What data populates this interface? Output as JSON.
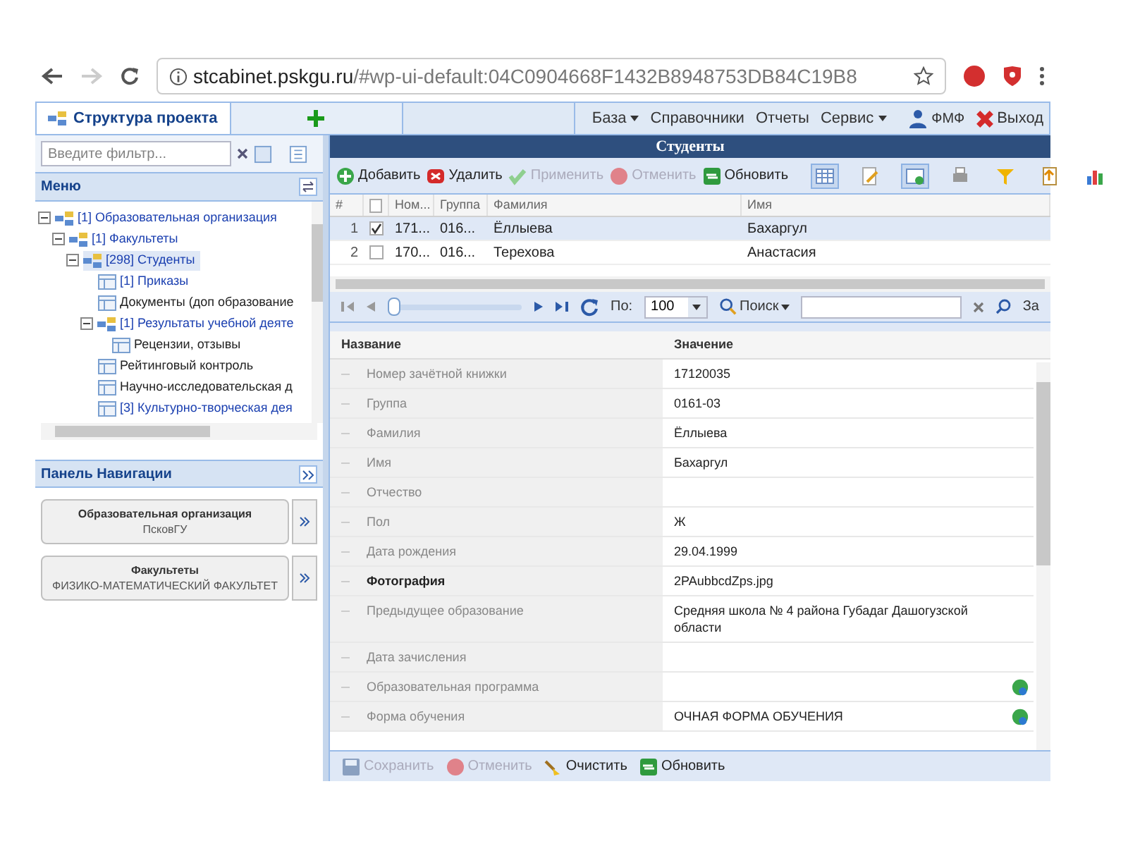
{
  "browser": {
    "url_host": "stcabinet.pskgu.ru",
    "url_path": "/#wp-ui-default:04C0904668F1432B8948753DB84C19B8"
  },
  "top_bar": {
    "tab": "Структура проекта",
    "menu": [
      {
        "label": "База",
        "dropdown": true
      },
      {
        "label": "Справочники",
        "dropdown": false
      },
      {
        "label": "Отчеты",
        "dropdown": false
      },
      {
        "label": "Сервис",
        "dropdown": true
      }
    ],
    "user": "ФМФ",
    "logout": "Выход"
  },
  "sidebar": {
    "filter": {
      "placeholder": "Введите фильтр..."
    },
    "menu_title": "Меню",
    "tree": [
      {
        "label": "[1] Образовательная организация",
        "kind": "folder",
        "color": "#1a3fb0",
        "expanded": true,
        "selected": false,
        "children": [
          {
            "label": "[1] Факультеты",
            "kind": "folder",
            "color": "#1a3fb0",
            "expanded": true,
            "selected": false,
            "children": [
              {
                "label": "[298] Студенты",
                "kind": "folder",
                "color": "#1a3fb0",
                "expanded": true,
                "selected": true,
                "children": [
                  {
                    "label": "[1] Приказы",
                    "kind": "table",
                    "color": "#1a3fb0",
                    "selected": false
                  },
                  {
                    "label": "Документы (доп образование",
                    "kind": "table",
                    "color": "#222222",
                    "selected": false
                  },
                  {
                    "label": "[1] Результаты учебной деяте",
                    "kind": "folder",
                    "color": "#1a3fb0",
                    "expanded": true,
                    "selected": false,
                    "children": [
                      {
                        "label": "Рецензии, отзывы",
                        "kind": "table",
                        "color": "#222222",
                        "selected": false
                      }
                    ]
                  },
                  {
                    "label": "Рейтинговый контроль",
                    "kind": "table",
                    "color": "#222222",
                    "selected": false
                  },
                  {
                    "label": "Научно-исследовательская д",
                    "kind": "table",
                    "color": "#222222",
                    "selected": false
                  },
                  {
                    "label": "[3] Культурно-творческая дея",
                    "kind": "table",
                    "color": "#1a3fb0",
                    "selected": false
                  }
                ]
              }
            ]
          }
        ]
      }
    ],
    "nav_panel": {
      "title": "Панель Навигации",
      "cards": [
        {
          "title": "Образовательная организация",
          "subtitle": "ПсковГУ"
        },
        {
          "title": "Факультеты",
          "subtitle": "ФИЗИКО-МАТЕМАТИЧЕСКИЙ ФАКУЛЬТЕТ"
        }
      ]
    }
  },
  "main": {
    "title": "Студенты",
    "toolbar": [
      {
        "label": "Добавить",
        "kind": "add",
        "disabled": false
      },
      {
        "label": "Удалить",
        "kind": "delete",
        "disabled": false
      },
      {
        "label": "Применить",
        "kind": "apply",
        "disabled": true
      },
      {
        "label": "Отменить",
        "kind": "cancel",
        "disabled": true
      },
      {
        "label": "Обновить",
        "kind": "refresh",
        "disabled": false
      }
    ],
    "tool_icons": [
      {
        "kind": "grid",
        "pressed": true
      },
      {
        "kind": "edit",
        "pressed": false
      },
      {
        "kind": "form",
        "pressed": true
      },
      {
        "kind": "print",
        "pressed": false
      },
      {
        "kind": "filter",
        "pressed": false
      },
      {
        "kind": "export",
        "pressed": false
      },
      {
        "kind": "chart",
        "pressed": false
      }
    ],
    "table": {
      "columns": [
        "#",
        "",
        "Ном...",
        "Группа",
        "Фамилия",
        "Имя"
      ],
      "header_checked": false,
      "rows": [
        {
          "checked": true,
          "selected": true,
          "cells": [
            "1",
            "",
            "171...",
            "016...",
            "Ёллыева",
            "Бахаргул"
          ]
        },
        {
          "checked": false,
          "selected": false,
          "cells": [
            "2",
            "",
            "170...",
            "016...",
            "Терехова",
            "Анастасия"
          ]
        }
      ]
    },
    "pager": {
      "level": 0,
      "page_size_label": "По:",
      "page_size": "100",
      "search": "Поиск",
      "cut_label": "За"
    },
    "properties": {
      "columns": [
        "Название",
        "Значение"
      ],
      "rows": [
        {
          "name": "Номер зачётной книжки",
          "value": "17120035",
          "emphasized": false,
          "lookup": false
        },
        {
          "name": "Группа",
          "value": "0161-03",
          "emphasized": false,
          "lookup": false
        },
        {
          "name": "Фамилия",
          "value": "Ёллыева",
          "emphasized": false,
          "lookup": false
        },
        {
          "name": "Имя",
          "value": "Бахаргул",
          "emphasized": false,
          "lookup": false
        },
        {
          "name": "Отчество",
          "emphasized": false,
          "lookup": false
        },
        {
          "name": "Пол",
          "value": "Ж",
          "emphasized": false,
          "lookup": false
        },
        {
          "name": "Дата рождения",
          "value": "29.04.1999",
          "emphasized": false,
          "lookup": false
        },
        {
          "name": "Фотография",
          "value": "2PAubbcdZps.jpg",
          "emphasized": true,
          "lookup": false
        },
        {
          "name": "Предыдущее образование",
          "value": "Средняя школа № 4 района Губадаг Дашогузской области",
          "emphasized": false,
          "lookup": false
        },
        {
          "name": "Дата зачисления",
          "emphasized": false,
          "lookup": false
        },
        {
          "name": "Образовательная программа",
          "emphasized": false,
          "lookup": true
        },
        {
          "name": "Форма обучения",
          "value": "ОЧНАЯ ФОРМА ОБУЧЕНИЯ",
          "emphasized": false,
          "lookup": true
        }
      ]
    },
    "footer": [
      {
        "label": "Сохранить",
        "kind": "save",
        "disabled": true
      },
      {
        "label": "Отменить",
        "kind": "cancel",
        "disabled": true
      },
      {
        "label": "Очистить",
        "kind": "clear",
        "disabled": false
      },
      {
        "label": "Обновить",
        "kind": "refresh",
        "disabled": false
      }
    ]
  }
}
